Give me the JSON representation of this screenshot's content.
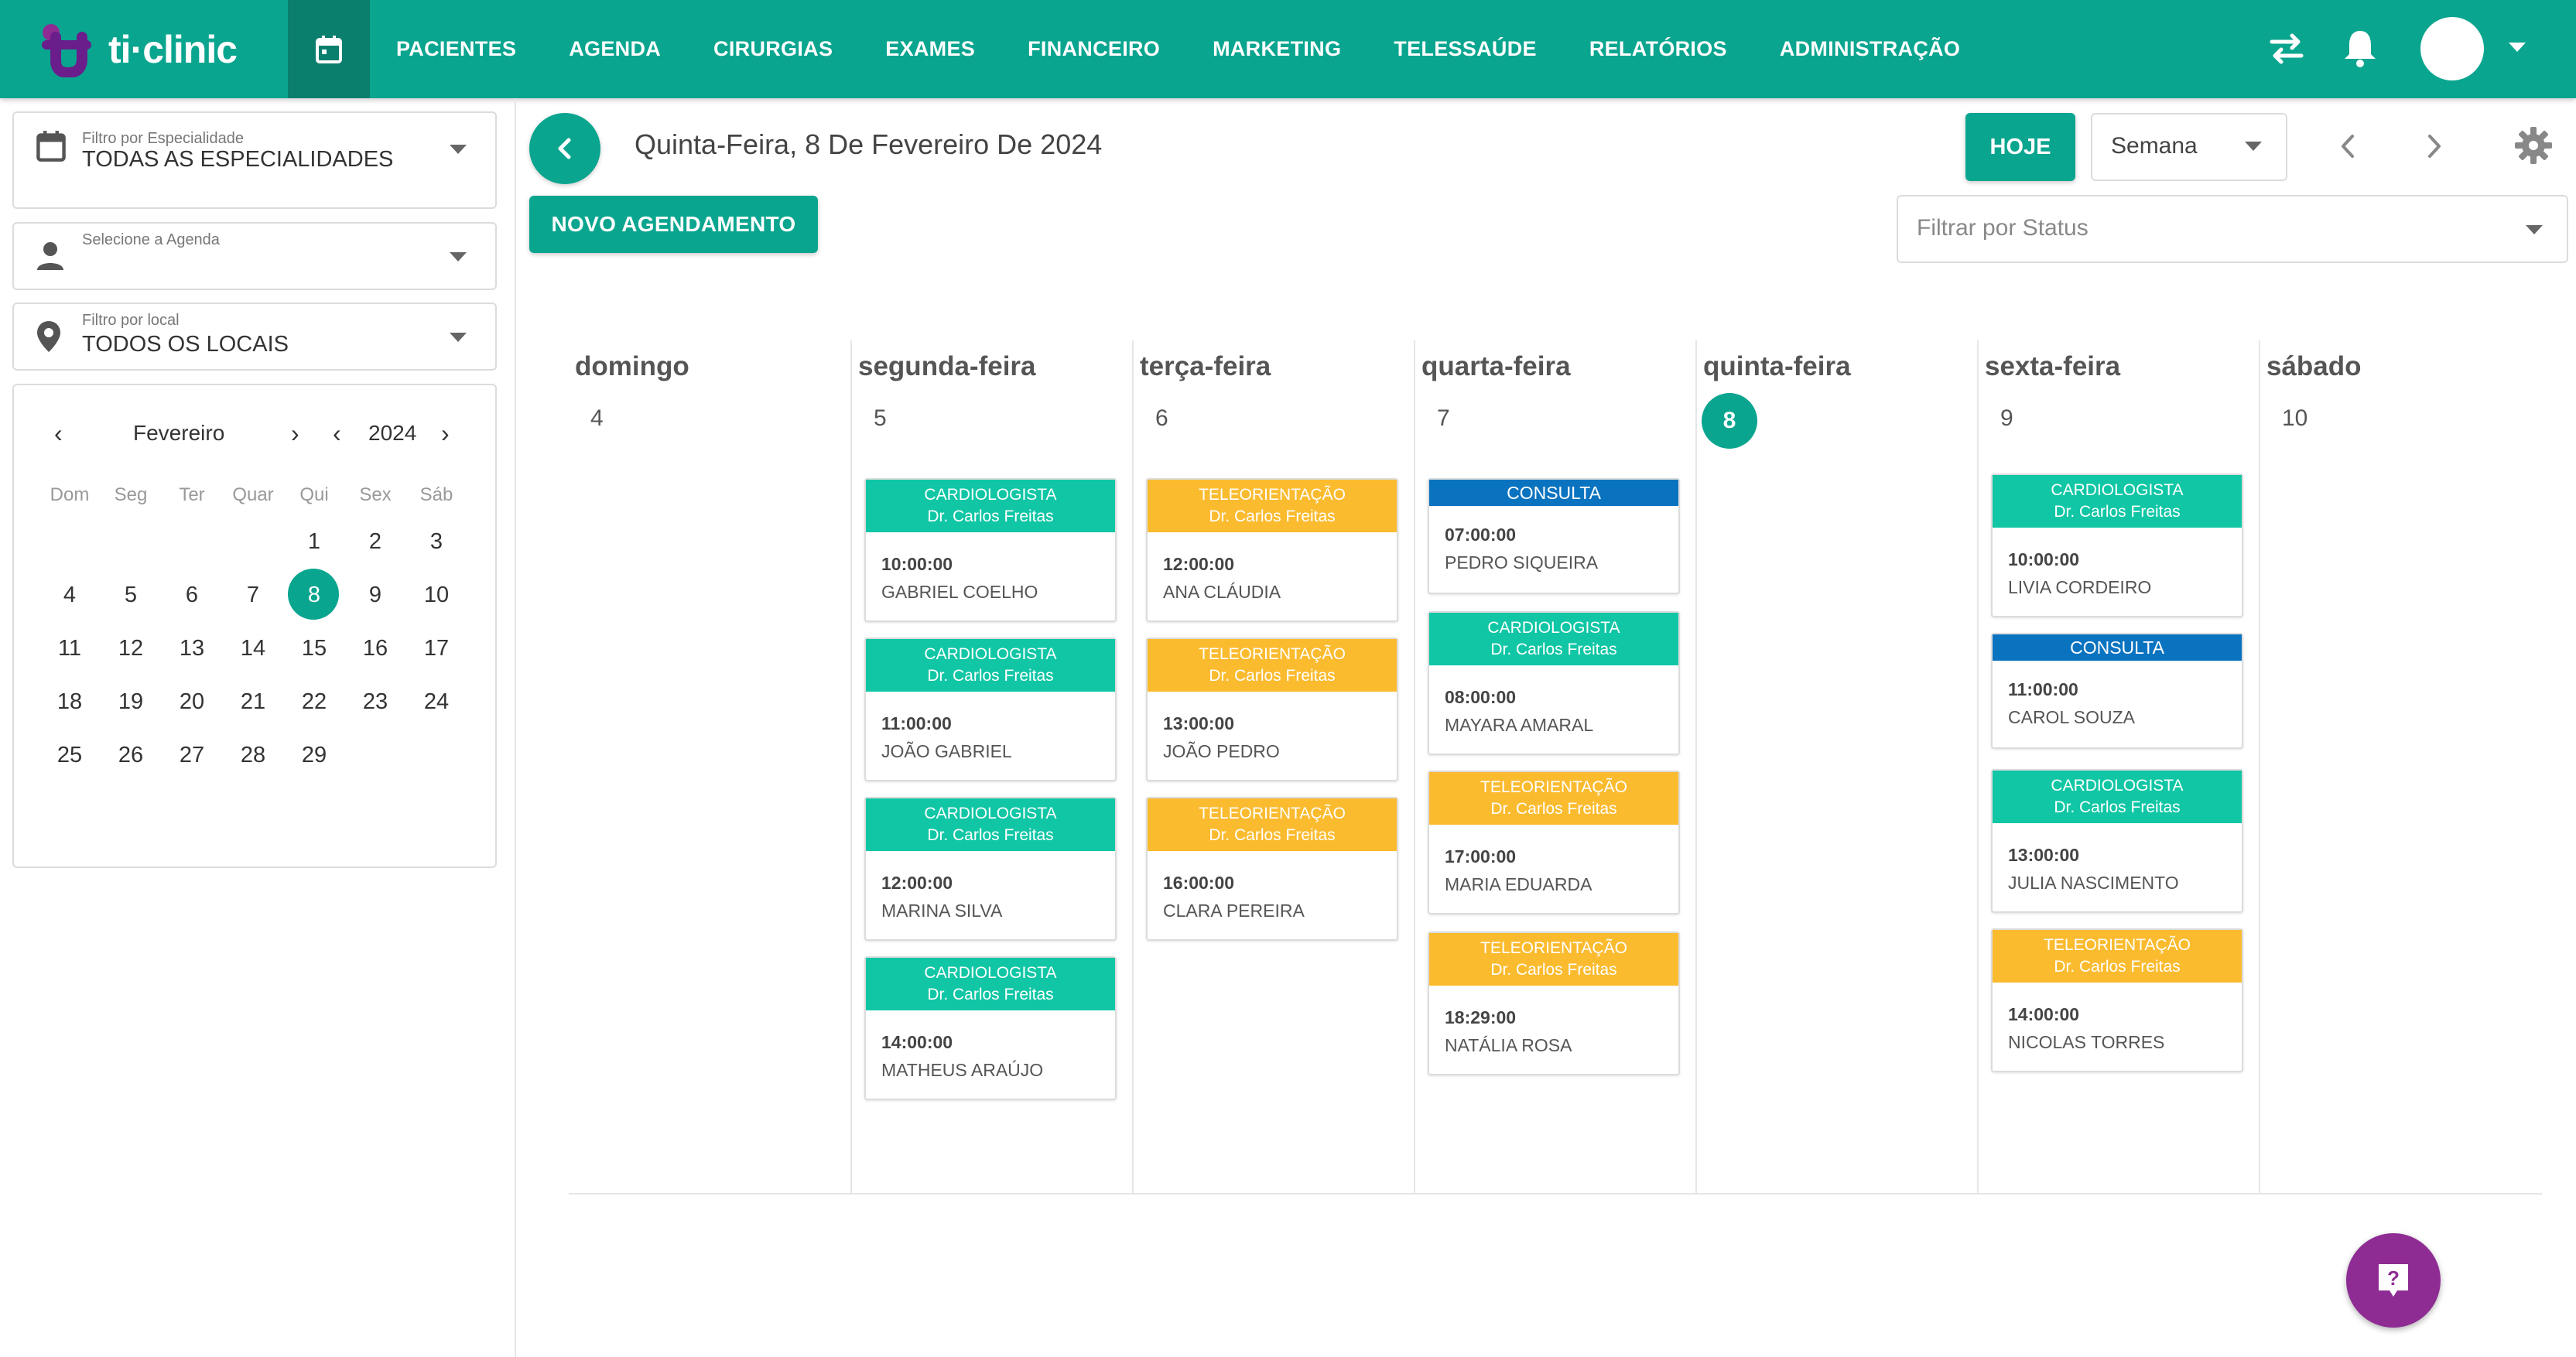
{
  "brand": {
    "name": "ti·clinic"
  },
  "nav": [
    "PACIENTES",
    "AGENDA",
    "CIRURGIAS",
    "EXAMES",
    "FINANCEIRO",
    "MARKETING",
    "TELESSAÚDE",
    "RELATÓRIOS",
    "ADMINISTRAÇÃO"
  ],
  "filters": {
    "especialidade": {
      "label": "Filtro por Especialidade",
      "value": "TODAS AS ESPECIALIDADES"
    },
    "agenda": {
      "label": "Selecione a Agenda",
      "value": ""
    },
    "local": {
      "label": "Filtro por local",
      "value": "TODOS OS LOCAIS"
    }
  },
  "mini_calendar": {
    "month": "Fevereiro",
    "year": "2024",
    "weekdays": [
      "Dom",
      "Seg",
      "Ter",
      "Quar",
      "Qui",
      "Sex",
      "Sáb"
    ],
    "days": [
      "1",
      "2",
      "3",
      "4",
      "5",
      "6",
      "7",
      "8",
      "9",
      "10",
      "11",
      "12",
      "13",
      "14",
      "15",
      "16",
      "17",
      "18",
      "19",
      "20",
      "21",
      "22",
      "23",
      "24",
      "25",
      "26",
      "27",
      "28",
      "29"
    ],
    "selected": "8"
  },
  "header": {
    "date_title": "Quinta-Feira, 8 De Fevereiro De 2024",
    "new_button": "NOVO AGENDAMENTO",
    "today_button": "HOJE",
    "view": "Semana",
    "status_placeholder": "Filtrar por Status"
  },
  "week": [
    {
      "name": "domingo",
      "num": "4",
      "today": false,
      "appts": []
    },
    {
      "name": "segunda-feira",
      "num": "5",
      "today": false,
      "appts": [
        {
          "type": "c",
          "title": "CARDIOLOGISTA",
          "doctor": "Dr. Carlos Freitas",
          "time": "10:00:00",
          "patient": "GABRIEL COELHO"
        },
        {
          "type": "c",
          "title": "CARDIOLOGISTA",
          "doctor": "Dr. Carlos Freitas",
          "time": "11:00:00",
          "patient": "JOÃO GABRIEL"
        },
        {
          "type": "c",
          "title": "CARDIOLOGISTA",
          "doctor": "Dr. Carlos Freitas",
          "time": "12:00:00",
          "patient": "MARINA SILVA"
        },
        {
          "type": "c",
          "title": "CARDIOLOGISTA",
          "doctor": "Dr. Carlos Freitas",
          "time": "14:00:00",
          "patient": "MATHEUS ARAÚJO"
        }
      ]
    },
    {
      "name": "terça-feira",
      "num": "6",
      "today": false,
      "appts": [
        {
          "type": "t",
          "title": "TELEORIENTAÇÃO",
          "doctor": "Dr. Carlos Freitas",
          "time": "12:00:00",
          "patient": "ANA CLÁUDIA"
        },
        {
          "type": "t",
          "title": "TELEORIENTAÇÃO",
          "doctor": "Dr. Carlos Freitas",
          "time": "13:00:00",
          "patient": "JOÃO PEDRO"
        },
        {
          "type": "t",
          "title": "TELEORIENTAÇÃO",
          "doctor": "Dr. Carlos Freitas",
          "time": "16:00:00",
          "patient": "CLARA PEREIRA"
        }
      ]
    },
    {
      "name": "quarta-feira",
      "num": "7",
      "today": false,
      "appts": [
        {
          "type": "k",
          "title": "CONSULTA",
          "doctor": "",
          "time": "07:00:00",
          "patient": "PEDRO SIQUEIRA"
        },
        {
          "type": "c",
          "title": "CARDIOLOGISTA",
          "doctor": "Dr. Carlos Freitas",
          "time": "08:00:00",
          "patient": "MAYARA AMARAL"
        },
        {
          "type": "t",
          "title": "TELEORIENTAÇÃO",
          "doctor": "Dr. Carlos Freitas",
          "time": "17:00:00",
          "patient": "MARIA EDUARDA"
        },
        {
          "type": "t",
          "title": "TELEORIENTAÇÃO",
          "doctor": "Dr. Carlos Freitas",
          "time": "18:29:00",
          "patient": "NATÁLIA ROSA"
        }
      ]
    },
    {
      "name": "quinta-feira",
      "num": "8",
      "today": true,
      "appts": []
    },
    {
      "name": "sexta-feira",
      "num": "9",
      "today": false,
      "appts": [
        {
          "type": "c",
          "title": "CARDIOLOGISTA",
          "doctor": "Dr. Carlos Freitas",
          "time": "10:00:00",
          "patient": "LIVIA CORDEIRO"
        },
        {
          "type": "k",
          "title": "CONSULTA",
          "doctor": "",
          "time": "11:00:00",
          "patient": "CAROL SOUZA"
        },
        {
          "type": "c",
          "title": "CARDIOLOGISTA",
          "doctor": "Dr. Carlos Freitas",
          "time": "13:00:00",
          "patient": "JULIA NASCIMENTO"
        },
        {
          "type": "t",
          "title": "TELEORIENTAÇÃO",
          "doctor": "Dr. Carlos Freitas",
          "time": "14:00:00",
          "patient": "NICOLAS TORRES"
        }
      ]
    },
    {
      "name": "sábado",
      "num": "10",
      "today": false,
      "appts": []
    }
  ],
  "colors": {
    "primary": "#0aa58f",
    "cardiologista": "#10c6a5",
    "teleorientacao": "#fbbb2f",
    "consulta": "#0a73c0",
    "help": "#8e2c93"
  },
  "icons": [
    "calendar-icon",
    "swap-icon",
    "bell-icon",
    "person-icon",
    "location-pin-icon",
    "gear-icon",
    "help-icon"
  ]
}
